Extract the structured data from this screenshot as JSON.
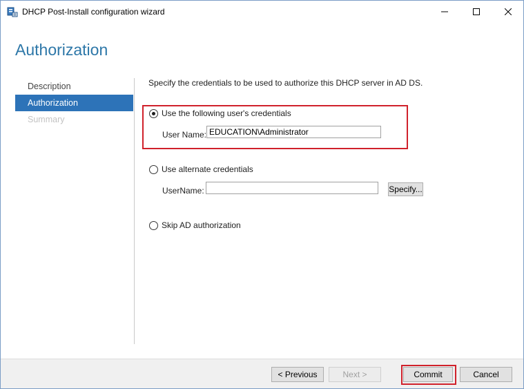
{
  "window": {
    "title": "DHCP Post-Install configuration wizard"
  },
  "header": {
    "title": "Authorization"
  },
  "nav": {
    "items": [
      {
        "label": "Description",
        "state": "normal"
      },
      {
        "label": "Authorization",
        "state": "active"
      },
      {
        "label": "Summary",
        "state": "disabled"
      }
    ]
  },
  "main": {
    "intro": "Specify the credentials to be used to authorize this DHCP server in AD DS.",
    "option_current": {
      "label": "Use the following user's credentials",
      "selected": true,
      "username_label": "User Name:",
      "username_value": "EDUCATION\\Administrator"
    },
    "option_alternate": {
      "label": "Use alternate credentials",
      "selected": false,
      "username_label": "UserName:",
      "username_value": "",
      "specify_label": "Specify..."
    },
    "option_skip": {
      "label": "Skip AD authorization",
      "selected": false
    }
  },
  "footer": {
    "previous_label": "< Previous",
    "next_label": "Next >",
    "commit_label": "Commit",
    "cancel_label": "Cancel"
  },
  "colors": {
    "accent": "#2d73b8",
    "heading": "#2d77a8",
    "highlight": "#d0202a"
  }
}
